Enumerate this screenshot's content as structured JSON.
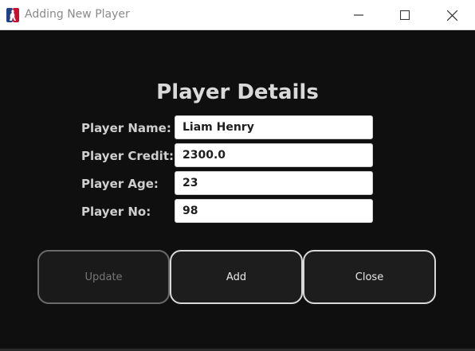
{
  "window": {
    "title": "Adding New Player",
    "app_icon": "nba-logo-icon",
    "controls": [
      "minimize-icon",
      "maximize-icon",
      "close-icon"
    ]
  },
  "form": {
    "heading": "Player Details",
    "fields": [
      {
        "label": "Player Name:",
        "value": "Liam Henry"
      },
      {
        "label": "Player Credit:",
        "value": "2300.0"
      },
      {
        "label": "Player Age:",
        "value": "23"
      },
      {
        "label": "Player No:",
        "value": "98"
      }
    ]
  },
  "actions": {
    "update_label": "Update",
    "add_label": "Add",
    "close_label": "Close"
  },
  "colors": {
    "background": "#0f0f10",
    "titlebar": "#ffffff",
    "heading_text": "#d9d9d9",
    "button_border": "#d8d8d8",
    "disabled_border": "#6a6a6a"
  }
}
